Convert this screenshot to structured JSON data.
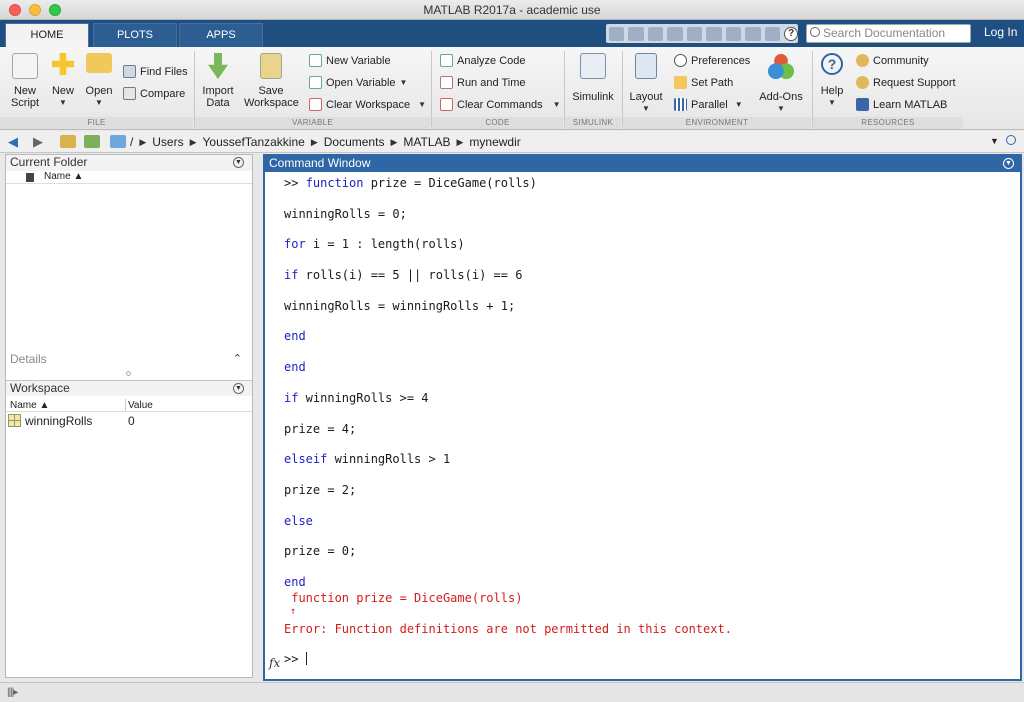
{
  "window": {
    "title": "MATLAB R2017a - academic use"
  },
  "tabs": [
    {
      "label": "HOME"
    },
    {
      "label": "PLOTS"
    },
    {
      "label": "APPS"
    }
  ],
  "search": {
    "placeholder": "Search Documentation"
  },
  "login_label": "Log In",
  "toolstrip": {
    "file": {
      "group": "FILE",
      "new_script": [
        "New",
        "Script"
      ],
      "new": "New",
      "open": "Open",
      "find_files": "Find Files",
      "compare": "Compare"
    },
    "variable": {
      "group": "VARIABLE",
      "import_data": [
        "Import",
        "Data"
      ],
      "save_workspace": [
        "Save",
        "Workspace"
      ],
      "new_variable": "New Variable",
      "open_variable": "Open Variable",
      "clear_workspace": "Clear Workspace"
    },
    "code": {
      "group": "CODE",
      "analyze_code": "Analyze Code",
      "run_and_time": "Run and Time",
      "clear_commands": "Clear Commands"
    },
    "simulink": {
      "group": "SIMULINK",
      "simulink": "Simulink"
    },
    "environment": {
      "group": "ENVIRONMENT",
      "layout": "Layout",
      "preferences": "Preferences",
      "set_path": "Set Path",
      "parallel": "Parallel",
      "add_ons": "Add-Ons"
    },
    "resources": {
      "group": "RESOURCES",
      "help": "Help",
      "community": "Community",
      "request_support": "Request Support",
      "learn_matlab": "Learn MATLAB"
    }
  },
  "path": [
    "/",
    "Users",
    "YoussefTanzakkine",
    "Documents",
    "MATLAB",
    "mynewdir"
  ],
  "current_folder": {
    "title": "Current Folder",
    "col_name": "Name ▲"
  },
  "details": {
    "title": "Details"
  },
  "workspace": {
    "title": "Workspace",
    "col_name": "Name ▲",
    "col_value": "Value",
    "rows": [
      {
        "name": "winningRolls",
        "value": "0"
      }
    ]
  },
  "command_window": {
    "title": "Command Window",
    "lines": {
      "l1_prompt": ">> ",
      "l1_kw": "function",
      "l1_rest": " prize = DiceGame(rolls)",
      "l2": "winningRolls = 0;",
      "l3_kw": "for",
      "l3_rest": " i = 1 : length(rolls)",
      "l4_kw": "if",
      "l4_rest": " rolls(i) == 5 || rolls(i) == 6",
      "l5": "winningRolls = winningRolls + 1;",
      "l6_kw": "end",
      "l7_kw": "end",
      "l8_kw": "if",
      "l8_rest": " winningRolls >= 4",
      "l9": "prize = 4;",
      "l10_kw": "elseif",
      "l10_rest": " winningRolls > 1",
      "l11": "prize = 2;",
      "l12_kw": "else",
      "l13": "prize = 0;",
      "l14_kw": "end"
    },
    "error_echo": " function prize = DiceGame(rolls)",
    "error_caret": " ↑",
    "error_message": "Error: Function definitions are not permitted in this context.",
    "prompt": ">> "
  }
}
